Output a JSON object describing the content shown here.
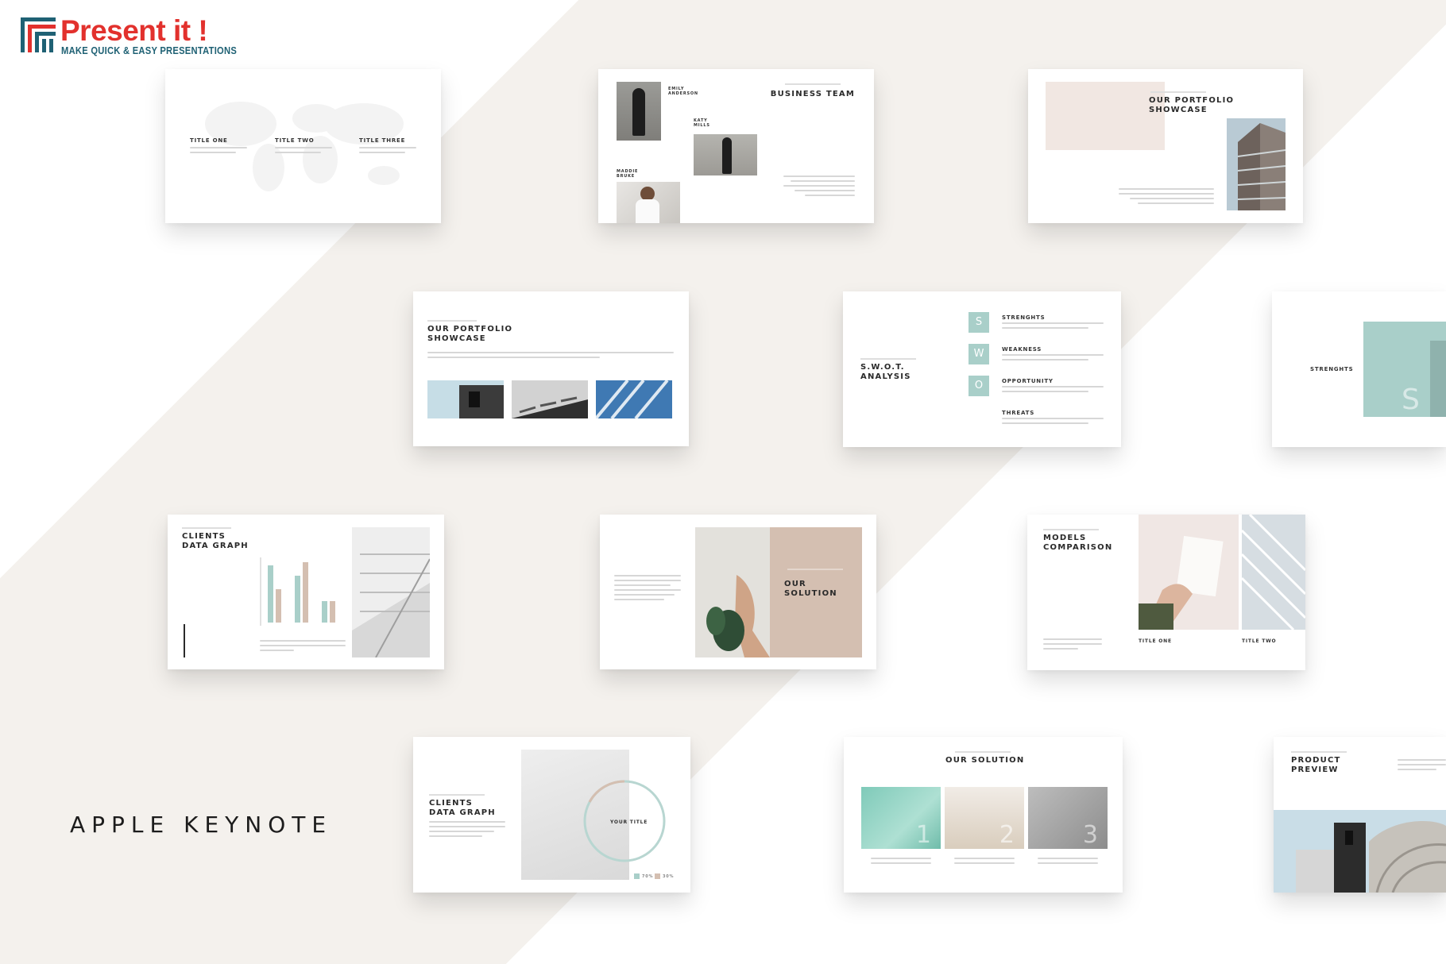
{
  "brand": {
    "name": "Present it !",
    "tagline": "MAKE QUICK & EASY PRESENTATIONS",
    "colors": {
      "red": "#e2312d",
      "teal": "#1f6174",
      "accent": "#a9cfc9",
      "sand": "#d4bfb1"
    }
  },
  "caption": "APPLE KEYNOTE",
  "slides": {
    "map": {
      "titles": [
        "TITLE ONE",
        "TITLE TWO",
        "TITLE THREE"
      ]
    },
    "team": {
      "title": "BUSINESS TEAM",
      "members": [
        "EMILY\nANDERSON",
        "KATY\nMILLS",
        "MADDIE\nBRUKE"
      ]
    },
    "portfolio_a": {
      "title": "OUR PORTFOLIO\nSHOWCASE"
    },
    "portfolio_b": {
      "title": "OUR PORTFOLIO\nSHOWCASE"
    },
    "swot": {
      "title": "S.W.O.T.\nANALYSIS",
      "letters": [
        "S",
        "W",
        "O"
      ],
      "items": [
        "STRENGHTS",
        "WEAKNESS",
        "OPPORTUNITY",
        "THREATS"
      ]
    },
    "strengths": {
      "label": "STRENGHTS",
      "letter": "S"
    },
    "clients_graph": {
      "title": "CLIENTS\nDATA GRAPH",
      "chart_data": {
        "type": "bar",
        "series": [
          {
            "color": "#a9cfc9",
            "values": [
              0.95,
              0.78,
              0.36
            ]
          },
          {
            "color": "#d4bfb1",
            "values": [
              0.55,
              1.0,
              0.36
            ]
          }
        ]
      }
    },
    "solution_a": {
      "title": "OUR\nSOLUTION"
    },
    "models": {
      "title": "MODELS\nCOMPARISON",
      "labels": [
        "TITLE ONE",
        "TITLE TWO"
      ]
    },
    "clients_circle": {
      "title": "CLIENTS\nDATA GRAPH",
      "center": "YOUR TITLE",
      "legend": [
        "70%",
        "30%"
      ]
    },
    "solution_b": {
      "title": "OUR SOLUTION",
      "numbers": [
        "1",
        "2",
        "3"
      ]
    },
    "product": {
      "title": "PRODUCT\nPREVIEW"
    }
  }
}
